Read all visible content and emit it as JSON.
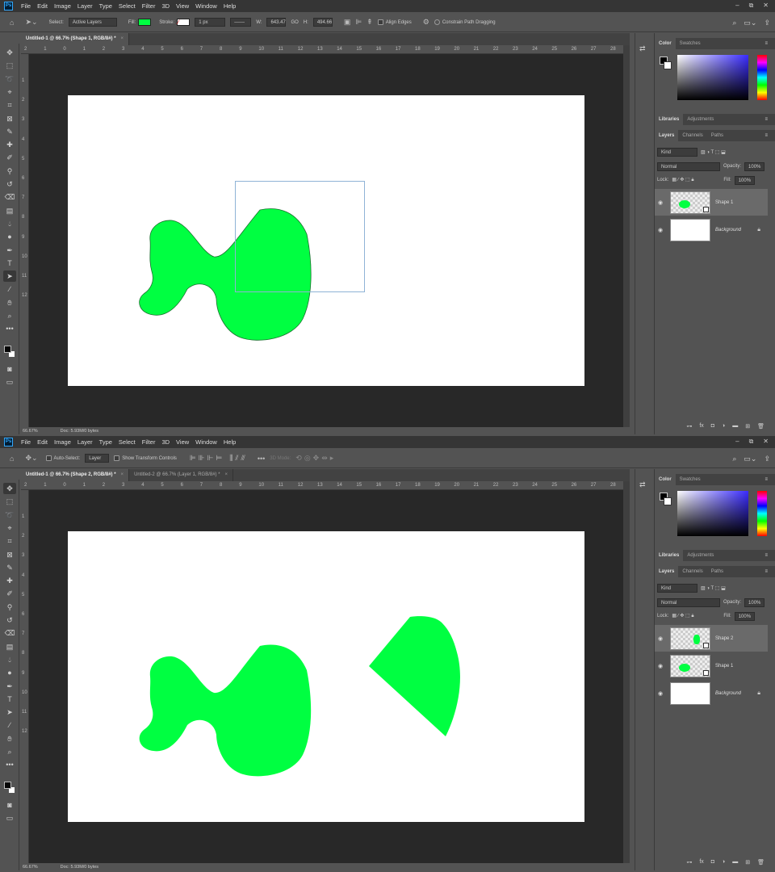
{
  "app": {
    "logo": "Ps"
  },
  "menu": [
    "File",
    "Edit",
    "Image",
    "Layer",
    "Type",
    "Select",
    "Filter",
    "3D",
    "View",
    "Window",
    "Help"
  ],
  "window_controls": {
    "minimize": "–",
    "restore": "⧉",
    "close": "✕"
  },
  "colors": {
    "fill": "#00ff41",
    "canvas": "#ffffff",
    "pasteboard": "#282828",
    "ui": "#535353"
  },
  "top": {
    "options": {
      "select_label": "Select:",
      "select_value": "Active Layers",
      "fill_label": "Fill:",
      "stroke_label": "Stroke:",
      "stroke_width": "1 px",
      "w_label": "W:",
      "w_value": "643.47",
      "link_label": "GO",
      "h_label": "H:",
      "h_value": "494.66",
      "align_edges": "Align Edges",
      "constrain": "Constrain Path Dragging"
    },
    "tabs": [
      {
        "title": "Untitled-1 @ 66.7% (Shape 1, RGB/8#) *",
        "close": "×"
      }
    ],
    "status": {
      "zoom": "66.67%",
      "doc": "Doc: 5.93M/0 bytes"
    },
    "layers": [
      {
        "name": "Shape 1",
        "selected": true
      },
      {
        "name": "Background",
        "locked": true
      }
    ]
  },
  "bottom": {
    "options": {
      "auto_select": "Auto-Select:",
      "layer_value": "Layer",
      "show_transform": "Show Transform Controls",
      "mode_3d": "3D Mode:"
    },
    "tabs": [
      {
        "title": "Untitled-1 @ 66.7% (Shape 2, RGB/8#) *",
        "close": "×"
      },
      {
        "title": "Untitled-2 @ 66.7% (Layer 1, RGB/8#) *",
        "close": "×"
      }
    ],
    "status": {
      "zoom": "66.67%",
      "doc": "Doc: 5.93M/0 bytes"
    },
    "layers": [
      {
        "name": "Shape 2",
        "selected": true
      },
      {
        "name": "Shape 1"
      },
      {
        "name": "Background",
        "locked": true
      }
    ]
  },
  "panels": {
    "color_tabs": [
      "Color",
      "Swatches"
    ],
    "lib_tabs": [
      "Libraries",
      "Adjustments"
    ],
    "layer_tabs": [
      "Layers",
      "Channels",
      "Paths"
    ],
    "kind": "Kind",
    "blend": "Normal",
    "opacity_label": "Opacity:",
    "opacity_value": "100%",
    "lock_label": "Lock:",
    "fill_label": "Fill:",
    "fill_value": "100%"
  },
  "ruler_ticks": [
    "2",
    "1",
    "0",
    "1",
    "2",
    "3",
    "4",
    "5",
    "6",
    "7",
    "8",
    "9",
    "10",
    "11",
    "12",
    "13",
    "14",
    "15",
    "16",
    "17",
    "18",
    "19",
    "20",
    "21",
    "22",
    "23",
    "24",
    "25",
    "26",
    "27",
    "28"
  ],
  "ruler_v_ticks": [
    "1",
    "2",
    "3",
    "4",
    "5",
    "6",
    "7",
    "8",
    "9",
    "10",
    "11",
    "12"
  ],
  "icons": {
    "tools": [
      "move-icon",
      "marquee-icon",
      "lasso-icon",
      "quick-select-icon",
      "crop-icon",
      "frame-icon",
      "eyedropper-icon",
      "healing-icon",
      "brush-icon",
      "stamp-icon",
      "history-brush-icon",
      "eraser-icon",
      "gradient-icon",
      "blur-icon",
      "dodge-icon",
      "pen-icon",
      "type-icon",
      "path-select-icon",
      "line-icon",
      "hand-icon",
      "zoom-icon",
      "more-icon"
    ]
  }
}
